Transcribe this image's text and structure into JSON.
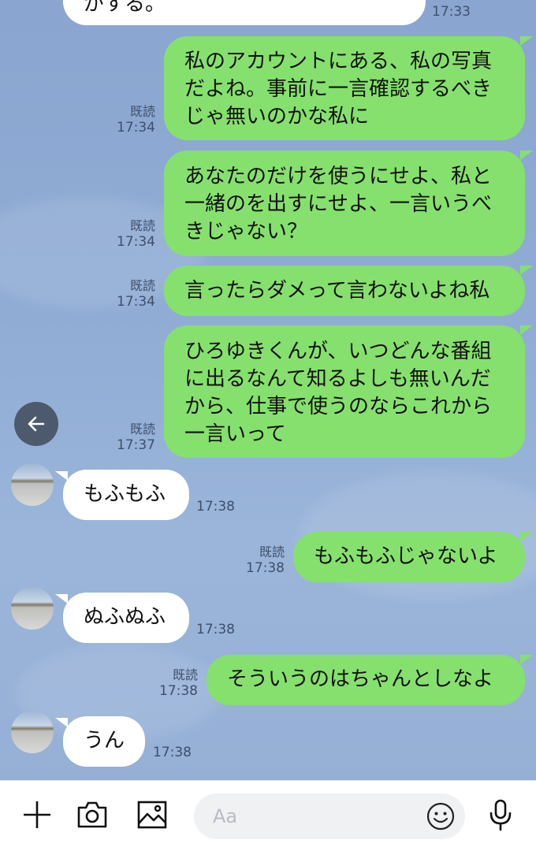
{
  "messages": {
    "m0": {
      "text": "がする。",
      "time": "17:33"
    },
    "m1": {
      "lines": [
        "私のアカウントにある、私の写真",
        "だよね。事前に一言確認するべき",
        "じゃ無いのかな私に"
      ],
      "read": "既読",
      "time": "17:34"
    },
    "m2": {
      "lines": [
        "あなたのだけを使うにせよ、私と",
        "一緒のを出すにせよ、一言いうべ",
        "きじゃない？"
      ],
      "read": "既読",
      "time": "17:34"
    },
    "m3": {
      "lines": [
        "言ったらダメって言わないよね私"
      ],
      "read": "既読",
      "time": "17:34"
    },
    "m4": {
      "lines": [
        "ひろゆきくんが、いつどんな番組",
        "に出るなんて知るよしも無いんだ",
        "から、仕事で使うのならこれから",
        "一言いって"
      ],
      "read": "既読",
      "time": "17:37"
    },
    "m5": {
      "text": "もふもふ",
      "time": "17:38"
    },
    "m6": {
      "text": "もふもふじゃないよ",
      "read": "既読",
      "time": "17:38"
    },
    "m7": {
      "text": "ぬふぬふ",
      "time": "17:38"
    },
    "m8": {
      "text": "そういうのはちゃんとしなよ",
      "read": "既読",
      "time": "17:38"
    },
    "m9": {
      "text": "うん",
      "time": "17:38"
    }
  },
  "input": {
    "placeholder": "Aa"
  },
  "icons": {
    "back": "arrow-left-icon",
    "add": "plus-icon",
    "camera": "camera-icon",
    "image": "image-icon",
    "emoji": "smiley-icon",
    "mic": "microphone-icon"
  },
  "colors": {
    "outgoing": "#86e06d",
    "incoming": "#ffffff",
    "background": "#8ca8d2"
  }
}
